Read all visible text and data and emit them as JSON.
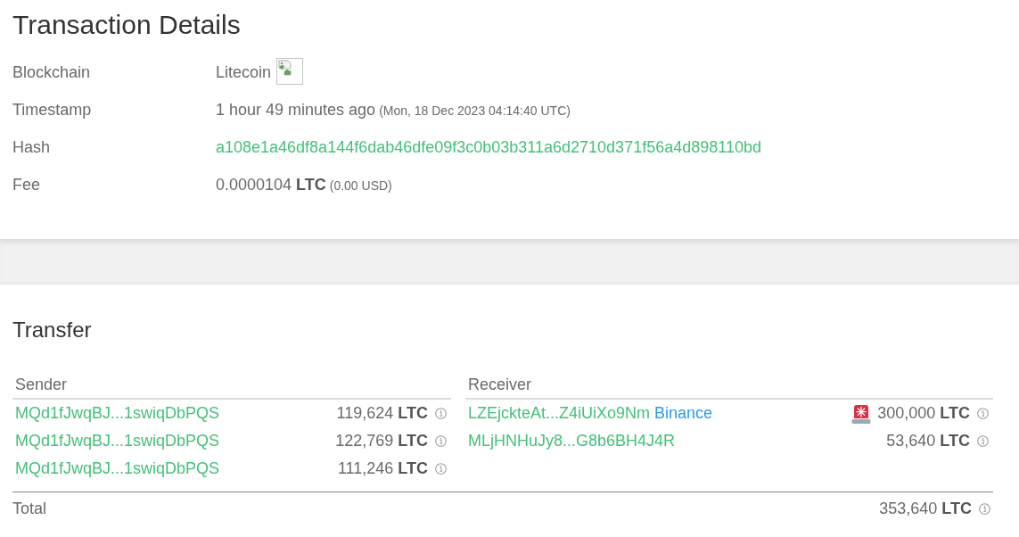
{
  "title": "Transaction Details",
  "details": [
    {
      "kind": "coin",
      "label": "Blockchain",
      "value": "Litecoin"
    },
    {
      "kind": "text",
      "label": "Timestamp",
      "value": "1 hour 49 minutes ago",
      "note": "(Mon, 18 Dec 2023 04:14:40 UTC)"
    },
    {
      "kind": "link",
      "label": "Hash",
      "value": "a108e1a46df8a144f6dab46dfe09f3c0b03b311a6d2710d371f56a4d898110bd"
    },
    {
      "kind": "text",
      "label": "Fee",
      "value": "0.0000104 **LTC**",
      "note": "(0.00 USD)"
    }
  ],
  "transfer": {
    "title": "Transfer",
    "sender": {
      "heading": "Sender",
      "rows": [
        {
          "address": "MQd1fJwqBJ...1swiqDbPQS",
          "amount": "119,624 **LTC**"
        },
        {
          "address": "MQd1fJwqBJ...1swiqDbPQS",
          "amount": "122,769 **LTC**"
        },
        {
          "address": "MQd1fJwqBJ...1swiqDbPQS",
          "amount": "111,246 **LTC**"
        }
      ]
    },
    "receiver": {
      "heading": "Receiver",
      "rows": [
        {
          "address": "LZEjckteAt...Z4iUiXo9Nm",
          "entity": "Binance",
          "flagged": true,
          "amount": "300,000 **LTC**"
        },
        {
          "address": "MLjHNHuJy8...G8b6BH4J4R",
          "flagged": false,
          "amount": "53,640 **LTC**"
        }
      ]
    },
    "total": {
      "label": "Total",
      "amount": "353,640 **LTC**"
    }
  }
}
